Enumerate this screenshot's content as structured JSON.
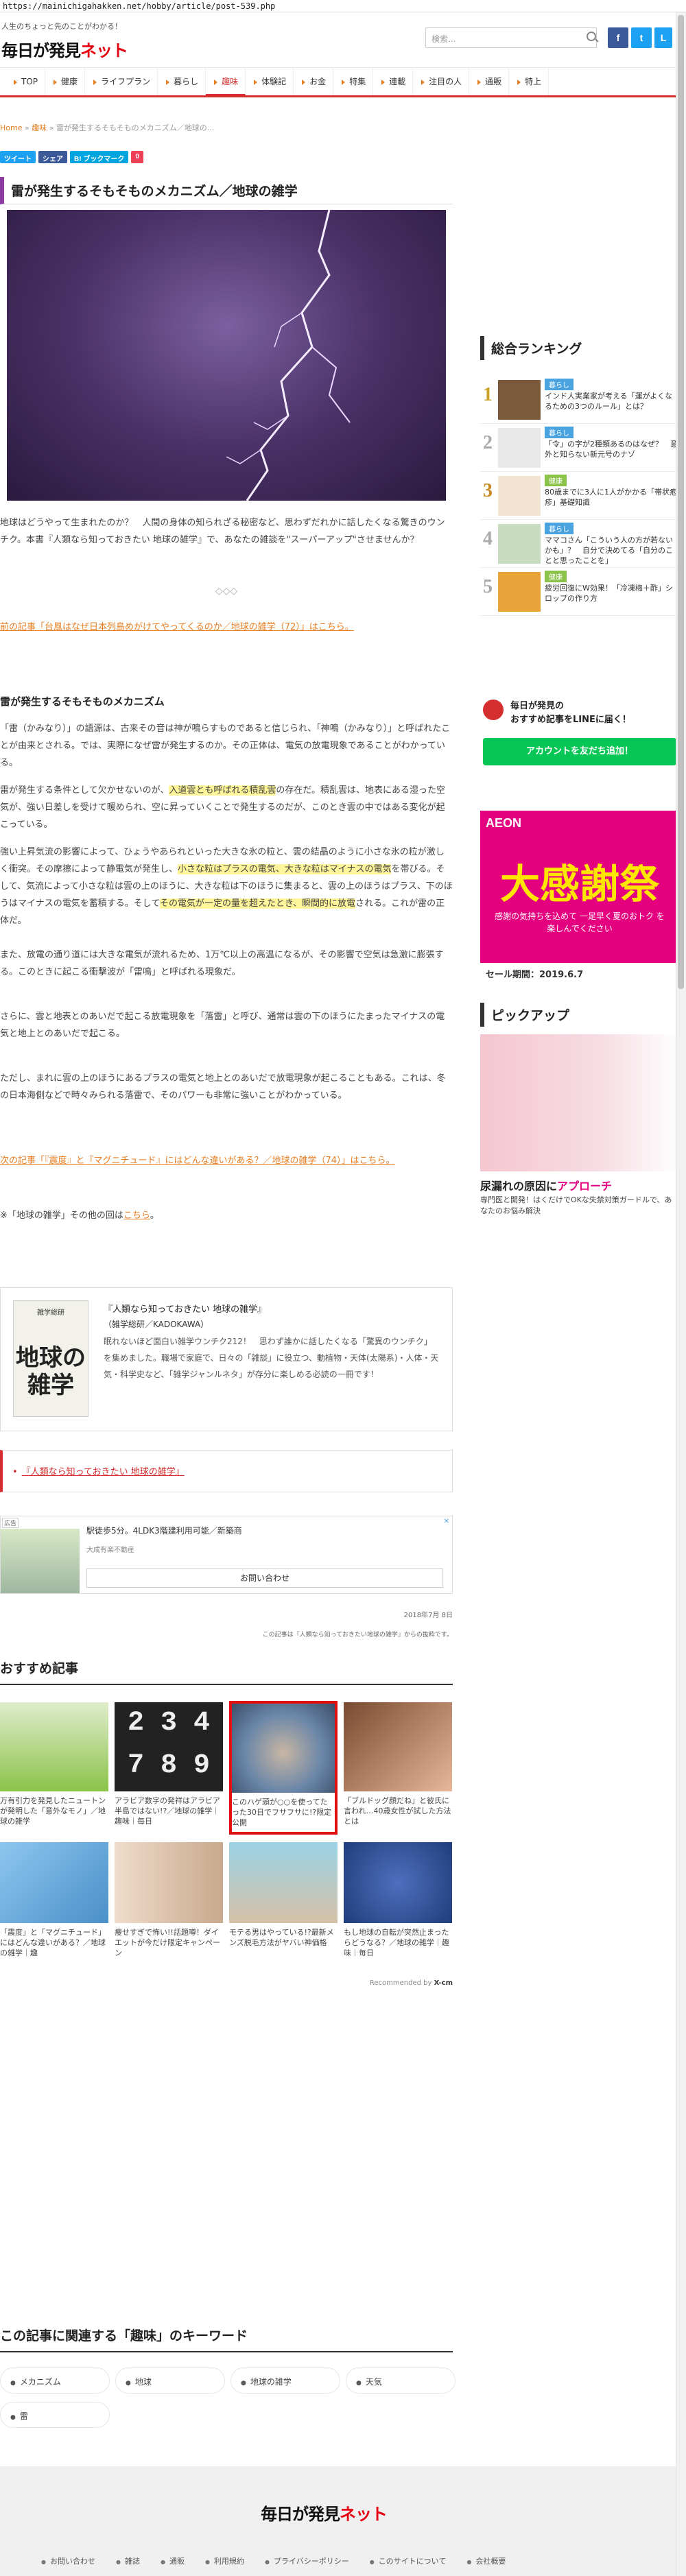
{
  "browser": {
    "url": "https://mainichigahakken.net/hobby/article/post-539.php"
  },
  "header": {
    "tagline": "人生のちょっと先のことがわかる！",
    "logo_main": "毎日が発見",
    "logo_red": "ネット",
    "search_placeholder": "検索...",
    "sns": [
      {
        "name": "facebook",
        "glyph": "f",
        "color": "#3b5998"
      },
      {
        "name": "twitter",
        "glyph": "t",
        "color": "#1da1f2"
      },
      {
        "name": "line",
        "glyph": "L",
        "color": "#1da1f2"
      }
    ]
  },
  "nav": {
    "items": [
      "TOP",
      "健康",
      "ライフプラン",
      "暮らし",
      "趣味",
      "体験記",
      "お金",
      "特集",
      "連載",
      "注目の人",
      "通販",
      "特上"
    ],
    "active_index": 4
  },
  "breadcrumb": {
    "home": "Home",
    "sep": "»",
    "category": "趣味",
    "current": "雷が発生するそもそものメカニズム／地球の..."
  },
  "share": {
    "buttons": [
      {
        "label": "ツイート",
        "color": "#1da1f2"
      },
      {
        "label": "シェア",
        "color": "#3b5998"
      },
      {
        "label": "B! ブックマーク",
        "color": "#00a4de"
      },
      {
        "label": "0",
        "color": "#ee4056"
      }
    ]
  },
  "article": {
    "title": "雷が発生するそもそものメカニズム／地球の雑学",
    "intro": "地球はどうやって生まれたのか？　人間の身体の知られざる秘密など、思わずだれかに話したくなる驚きのウンチク。本書『人類なら知っておきたい 地球の雑学』で、あなたの雑談を\"スーパーアップ\"させませんか？",
    "separator": "◇◇◇",
    "prev_link": "前の記事「台風はなぜ日本列島めがけてやってくるのか／地球の雑学（72）」はこちら。",
    "section_heading": "雷が発生するそもそものメカニズム",
    "paras": [
      "「雷（かみなり）」の語源は、古来その音は神が鳴らすものであると信じられ、「神鳴（かみなり）」と呼ばれたことが由来とされる。では、実際になぜ雷が発生するのか。その正体は、電気の放電現象であることがわかっている。",
      "雷が発生する条件として欠かせないのが、",
      "入道雲とも呼ばれる積乱雲",
      "の存在だ。積乱雲は、地表にある湿った空気が、強い日差しを受けて暖められ、空に昇っていくことで発生するのだが、このとき雲の中ではある変化が起こっている。",
      "強い上昇気流の影響によって、ひょうやあられといった大きな氷の粒と、雲の結晶のように小さな氷の粒が激しく衝突。その摩擦によって静電気が発生し、",
      "小さな粒はプラスの電気、大きな粒はマイナスの電気",
      "を帯びる。そして、気流によって小さな粒は雲の上のほうに、大きな粒は下のほうに集まると、雲の上のほうはプラス、下のほうはマイナスの電気を蓄積する。そして",
      "その電気が一定の量を超えたとき、瞬間的に放電",
      "される。これが雷の正体だ。",
      "また、放電の通り道には大きな電気が流れるため、1万℃以上の高温になるが、その影響で空気は急激に膨張する。このときに起こる衝撃波が「雷鳴」と呼ばれる現象だ。",
      "さらに、雲と地表とのあいだで起こる放電現象を「落雷」と呼び、通常は雲の下のほうにたまったマイナスの電気と地上とのあいだで起こる。",
      "ただし、まれに雲の上のほうにあるプラスの電気と地上とのあいだで放電現象が起こることもある。これは、冬の日本海側などで時々みられる落雷で、そのパワーも非常に強いことがわかっている。"
    ],
    "next_link": "次の記事「『震度』と『マグニチュード』にはどんな違いがある？／地球の雑学（74）」はこちら。",
    "series_note_pre": "※「地球の雑学」その他の回は",
    "series_note_link": "こちら",
    "series_note_post": "。",
    "book": {
      "title": "『人類なら知っておきたい 地球の雑学』",
      "publisher": "（雑学総研／KADOKAWA）",
      "desc": "眠れないほど面白い雑学ウンチク212！　思わず誰かに話したくなる「驚異のウンチク」を集めました。職場で家庭で、日々の「雑談」に役立つ、動植物・天体(太陽系)・人体・天気・科学史など、「雑学ジャンルネタ」が存分に楽しめる必読の一冊です！",
      "cover_top": "雑学総研",
      "cover_main": "地球の雑学"
    },
    "book_link": "『人類なら知っておきたい 地球の雑学』",
    "ad": {
      "label": "広告",
      "line1": "駅徒歩5分。4LDK3階建利用可能／新築商",
      "line2": "大成有楽不動産",
      "cta": "お問い合わせ"
    },
    "date": "2018年7月 8日",
    "credit": "この記事は『人類なら知っておきたい地球の雑学』からの抜粋です。"
  },
  "recommend": {
    "heading": "おすすめ記事",
    "items": [
      {
        "text": "万有引力を発見したニュートンが発明した「意外なモノ」／地球の雑学",
        "color": "#8bc34a"
      },
      {
        "text": "アラビア数字の発祥はアラビア半島ではない!?／地球の雑学｜趣味｜毎日",
        "color": "#222"
      },
      {
        "text": "このハゲ頭が○○を使ってたった30日でフサフサに!?限定公開",
        "color": "#6a86a8",
        "highlight": true
      },
      {
        "text": "「ブルドッグ顔だね」と彼氏に言われ…40歳女性が試した方法とは",
        "color": "#e8b79a"
      },
      {
        "text": "「震度」と「マグニチュード」にはどんな違いがある？／地球の雑学｜趣",
        "color": "#4a90c8"
      },
      {
        "text": "痩せすぎで怖い!!話題噂！ダイエットが今だけ限定キャンペーン",
        "color": "#c8a98d"
      },
      {
        "text": "モテる男はやっている!?最新メンズ脱毛方法がヤバい神価格",
        "color": "#9bd3e6"
      },
      {
        "text": "もし地球の自転が突然止まったらどうなる？／地球の雑学｜趣味｜毎日",
        "color": "#1f3d7a"
      }
    ],
    "credit": "Recommended by",
    "credit_brand": "X-cm"
  },
  "keywords": {
    "heading": "この記事に関連する「趣味」のキーワード",
    "items": [
      "メカニズム",
      "地球",
      "地球の雑学",
      "天気",
      "雷"
    ]
  },
  "sidebar": {
    "ranking_heading": "総合ランキング",
    "ranking": [
      {
        "no": "1",
        "tag": "暮らし",
        "text": "インド人実業家が考える「運がよくなるための3つのルール」とは？",
        "color": "#7a5a3a"
      },
      {
        "no": "2",
        "tag": "暮らし",
        "text": "「令」の字が2種類あるのはなぜ？　意外と知らない新元号のナゾ",
        "color": "#555"
      },
      {
        "no": "3",
        "tag": "健康",
        "text": "80歳までに3人に1人がかかる「帯状疱疹」基礎知識",
        "color": "#d9b48a"
      },
      {
        "no": "4",
        "tag": "暮らし",
        "text": "ママコさん「こういう人の方が若ないかも」？　自分で決めてる「自分のことと思ったことを」",
        "color": "#9cc7a0"
      },
      {
        "no": "5",
        "tag": "健康",
        "text": "疲労回復にW効果！「冷凍梅＋酢」シロップの作り方",
        "color": "#e8a33a"
      }
    ],
    "line_title": "毎日が発見の",
    "line_sub": "おすすめ記事をLINEに届く！",
    "line_button": "アカウントを友だち追加！",
    "aeon_logo": "AEON",
    "aeon_big": "大感謝祭",
    "aeon_sub": "感謝の気持ちを込めて 一足早く夏のおトク を楽しんでください",
    "aeon_sale": "セール期間：2019.6.7",
    "pickup_heading": "ピックアップ",
    "pickup_title_a": "尿漏れの原因に",
    "pickup_title_b": "アプローチ",
    "pickup_text": "専門医と開発！はくだけでOKな失禁対策ガードルで、あなたのお悩み解決"
  },
  "footer": {
    "logo_main": "毎日が発見",
    "logo_red": "ネット",
    "links": [
      "お問い合わせ",
      "雑誌",
      "通販",
      "利用規約",
      "プライバシーポリシー",
      "このサイトについて",
      "会社概要"
    ]
  },
  "colors": {
    "accent": "#d42e2e",
    "title_bar": "#8a3aa1",
    "link": "#e67e22",
    "highlight": "#fff59a",
    "line": "#06c755"
  }
}
